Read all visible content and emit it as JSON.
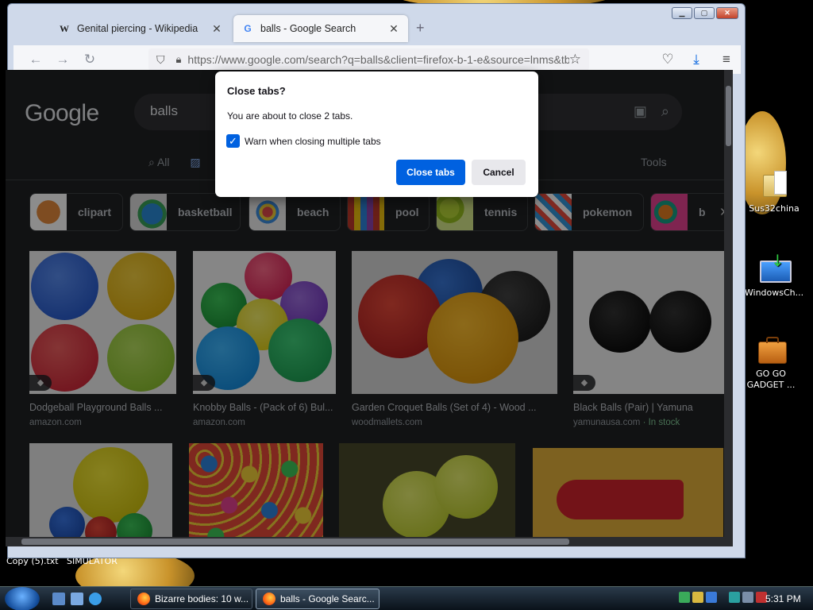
{
  "browser": {
    "tabs": [
      {
        "title": "Genital piercing - Wikipedia",
        "favicon": "W",
        "close": "✕"
      },
      {
        "title": "balls - Google Search",
        "favicon": "G",
        "close": "✕"
      }
    ],
    "new_tab": "+",
    "url": "https://www.google.com/search?q=balls&client=firefox-b-1-e&source=lnms&tbm=isch"
  },
  "google": {
    "logo": "Google",
    "query": "balls",
    "tab_all": "All",
    "tools": "Tools",
    "chips": [
      "clipart",
      "basketball",
      "beach",
      "pool",
      "tennis",
      "pokemon",
      "b"
    ],
    "results": [
      {
        "title": "Dodgeball Playground Balls ...",
        "source": "amazon.com"
      },
      {
        "title": "Knobby Balls - (Pack of 6) Bul...",
        "source": "amazon.com"
      },
      {
        "title": "Garden Croquet Balls (Set of 4) - Wood ...",
        "source": "woodmallets.com"
      },
      {
        "title": "Black Balls (Pair) | Yamuna",
        "source": "yamunausa.com",
        "stock": " · In stock"
      }
    ]
  },
  "dialog": {
    "title": "Close tabs?",
    "message": "You are about to close 2 tabs.",
    "checkbox_label": "Warn when closing multiple tabs",
    "checkbox_checked": true,
    "confirm": "Close tabs",
    "cancel": "Cancel"
  },
  "desktop": {
    "icons": [
      {
        "label": "Sus32china",
        "icon": "folder-icon"
      },
      {
        "label": "WindowsCh...",
        "icon": "monitor-download-icon"
      },
      {
        "label": "GO GO\nGADGET ...",
        "icon": "briefcase-icon"
      }
    ],
    "text_behind": [
      "Copy (5).txt",
      "SIMULATOR"
    ]
  },
  "taskbar": {
    "tasks": [
      {
        "label": "Bizarre bodies: 10 w..."
      },
      {
        "label": "balls - Google Searc..."
      }
    ],
    "clock": "5:31 PM"
  },
  "colors": {
    "accent": "#0061e0",
    "page_bg": "#202124"
  }
}
